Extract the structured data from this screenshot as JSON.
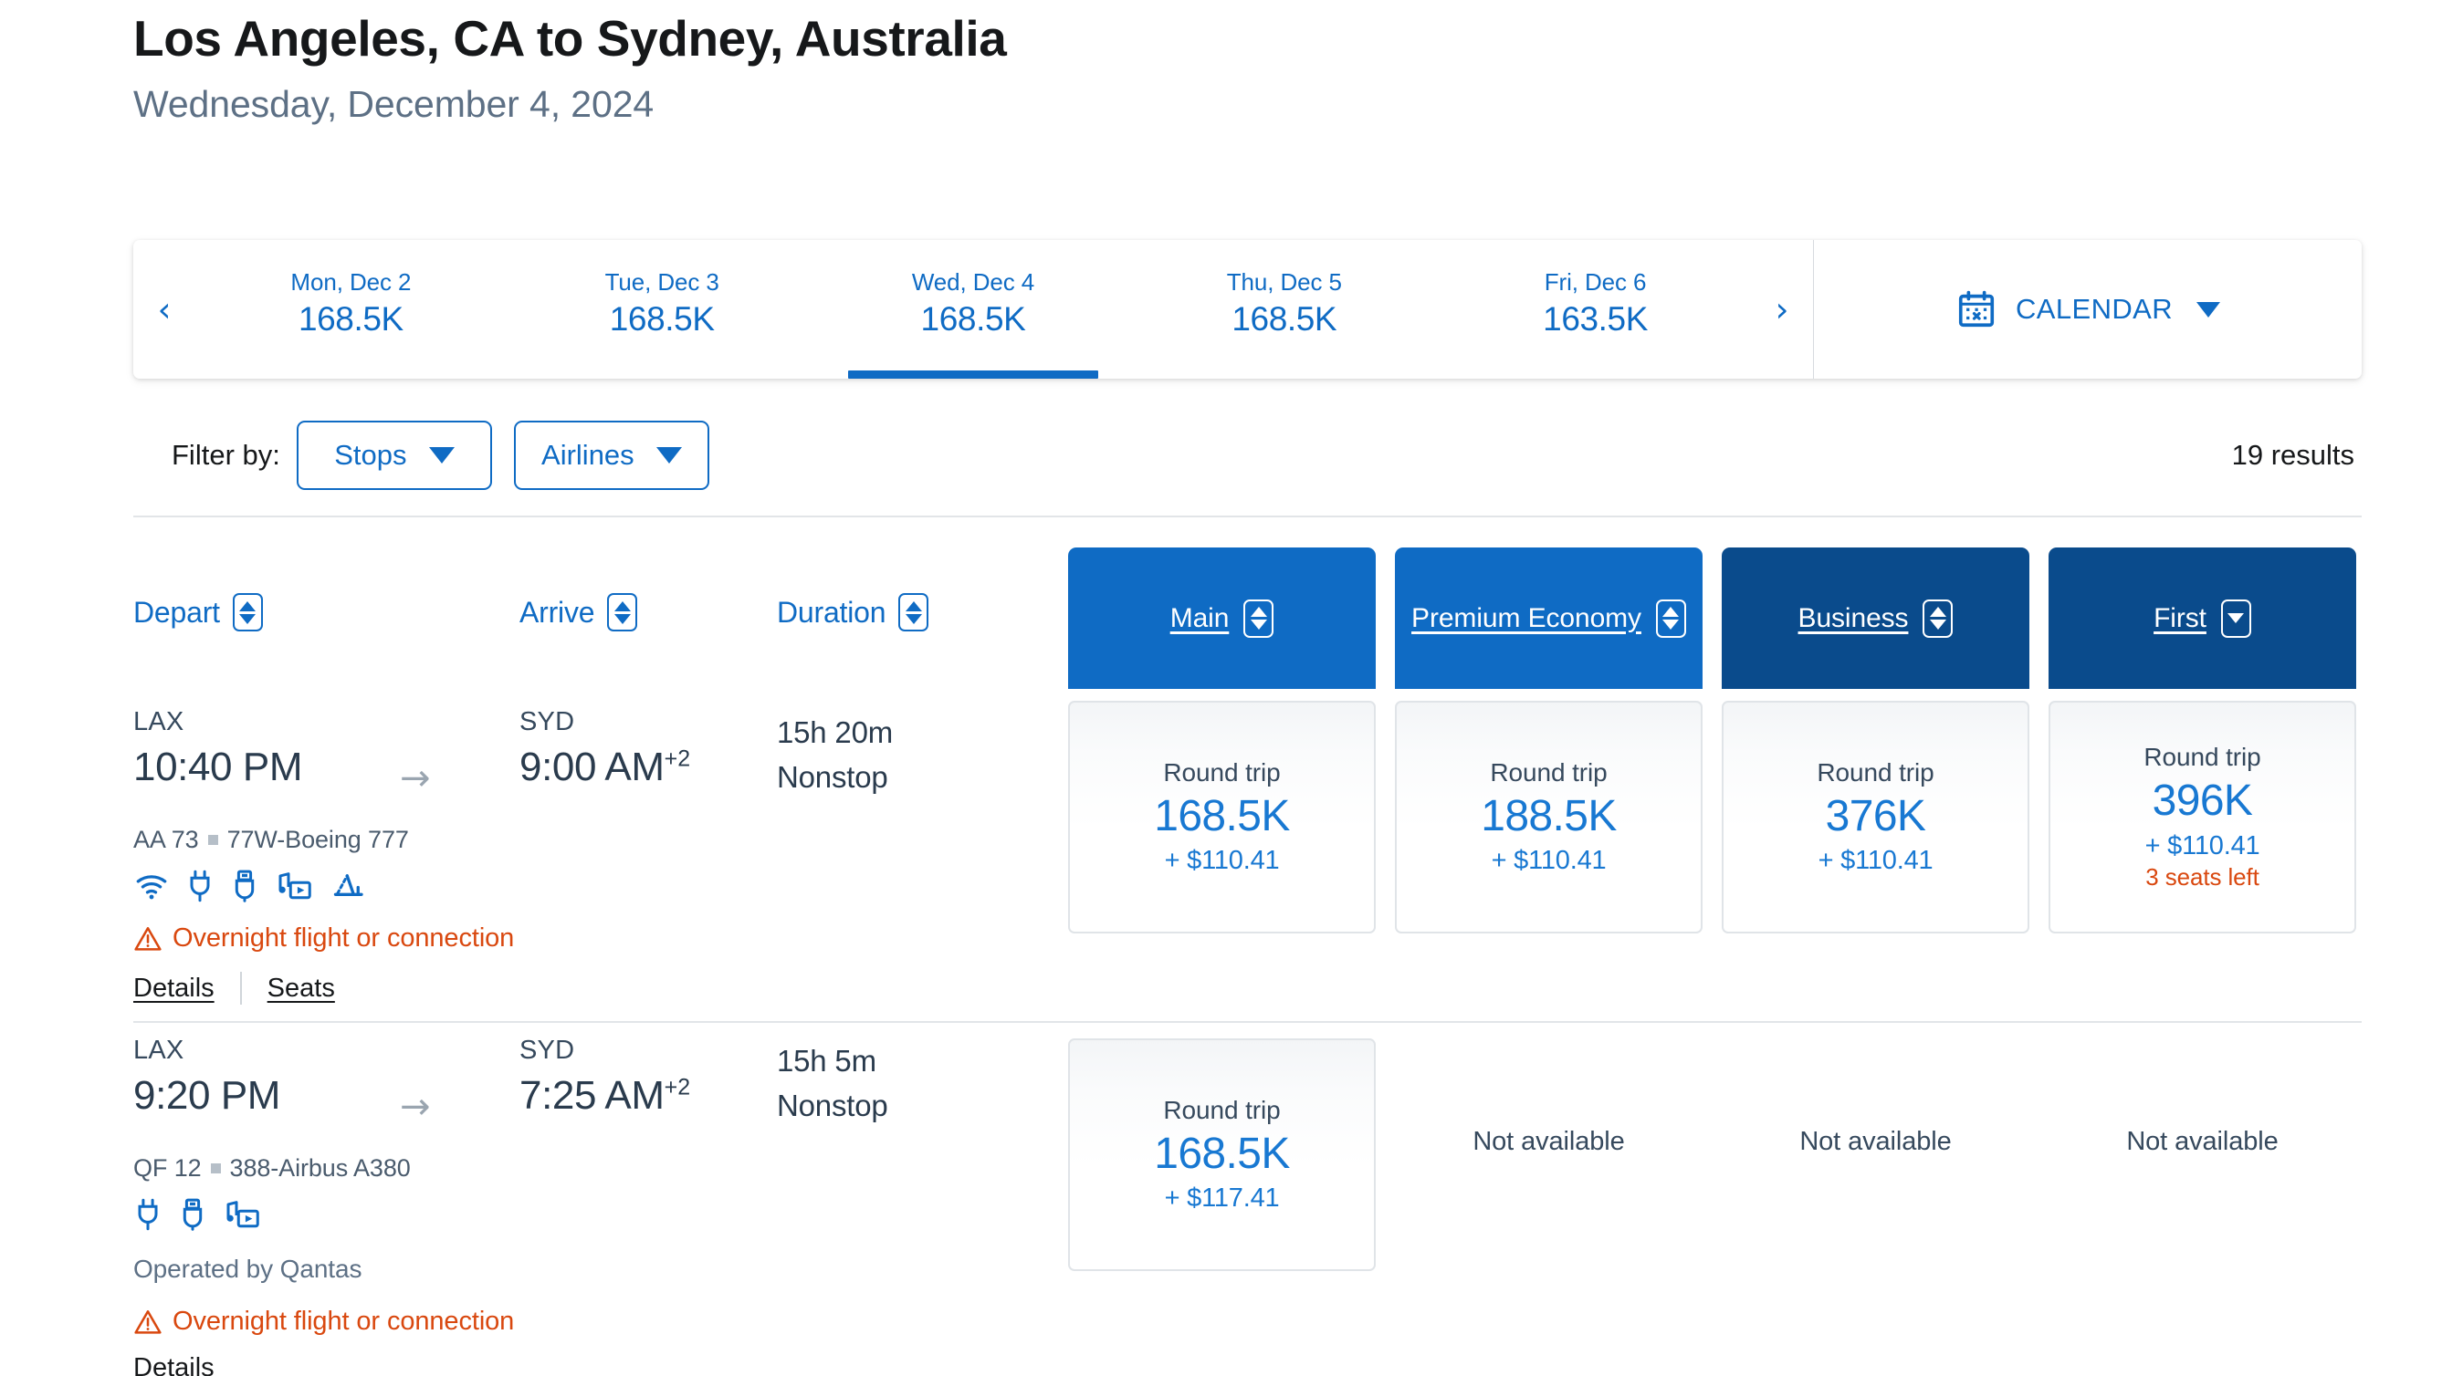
{
  "header": {
    "route_title": "Los Angeles, CA to Sydney, Australia",
    "route_date": "Wednesday, December 4, 2024"
  },
  "datestrip": {
    "prev_icon": "chevron-left-icon",
    "next_icon": "chevron-right-icon",
    "prev_glyph": "‹",
    "next_glyph": "›",
    "days": [
      {
        "label": "Mon, Dec 2",
        "price": "168.5K",
        "selected": false
      },
      {
        "label": "Tue, Dec 3",
        "price": "168.5K",
        "selected": false
      },
      {
        "label": "Wed, Dec 4",
        "price": "168.5K",
        "selected": true
      },
      {
        "label": "Thu, Dec 5",
        "price": "168.5K",
        "selected": false
      },
      {
        "label": "Fri, Dec 6",
        "price": "163.5K",
        "selected": false
      }
    ],
    "calendar_label": "CALENDAR",
    "calendar_icon": "calendar-icon"
  },
  "filters": {
    "label": "Filter by:",
    "buttons": [
      {
        "label": "Stops"
      },
      {
        "label": "Airlines"
      }
    ],
    "results_count": "19 results"
  },
  "columns": {
    "depart": "Depart",
    "arrive": "Arrive",
    "duration": "Duration"
  },
  "cabins": [
    {
      "label": "Main",
      "color": "#0f6bc4",
      "sort": "both"
    },
    {
      "label": "Premium Economy",
      "color": "#0f6bc4",
      "sort": "both"
    },
    {
      "label": "Business",
      "color": "#0a4b8c",
      "sort": "both"
    },
    {
      "label": "First",
      "color": "#0a4b8c",
      "sort": "down"
    }
  ],
  "flights": [
    {
      "depart_airport": "LAX",
      "depart_time": "10:40 PM",
      "arrive_airport": "SYD",
      "arrive_time": "9:00 AM",
      "arrive_day_offset": "+2",
      "duration": "15h 20m",
      "stops": "Nonstop",
      "flight_number": "AA 73",
      "aircraft": "77W-Boeing 777",
      "amenities": [
        "wifi-icon",
        "power-outlet-icon",
        "usb-port-icon",
        "entertainment-icon",
        "lie-flat-seat-icon"
      ],
      "operated_by": "",
      "warning": "Overnight flight or connection",
      "links": [
        "Details",
        "Seats"
      ],
      "fares": [
        {
          "available": true,
          "label": "Round trip",
          "miles": "168.5K",
          "cash": "+ $110.41",
          "seats_left": ""
        },
        {
          "available": true,
          "label": "Round trip",
          "miles": "188.5K",
          "cash": "+ $110.41",
          "seats_left": ""
        },
        {
          "available": true,
          "label": "Round trip",
          "miles": "376K",
          "cash": "+ $110.41",
          "seats_left": ""
        },
        {
          "available": true,
          "label": "Round trip",
          "miles": "396K",
          "cash": "+ $110.41",
          "seats_left": "3 seats left"
        }
      ]
    },
    {
      "depart_airport": "LAX",
      "depart_time": "9:20 PM",
      "arrive_airport": "SYD",
      "arrive_time": "7:25 AM",
      "arrive_day_offset": "+2",
      "duration": "15h 5m",
      "stops": "Nonstop",
      "flight_number": "QF 12",
      "aircraft": "388-Airbus A380",
      "amenities": [
        "power-outlet-icon",
        "usb-port-icon",
        "entertainment-icon"
      ],
      "operated_by": "Operated by Qantas",
      "warning": "Overnight flight or connection",
      "links": [
        "Details"
      ],
      "fares": [
        {
          "available": true,
          "label": "Round trip",
          "miles": "168.5K",
          "cash": "+ $117.41",
          "seats_left": ""
        },
        {
          "available": false,
          "unavailable_text": "Not available"
        },
        {
          "available": false,
          "unavailable_text": "Not available"
        },
        {
          "available": false,
          "unavailable_text": "Not available"
        }
      ]
    }
  ],
  "colors": {
    "link_blue": "#0f6bc4",
    "price_blue": "#1878d2",
    "cabin_light": "#0f6bc4",
    "cabin_dark": "#0a4b8c",
    "warning_orange": "#d9480f",
    "text_dark": "#2a3b4d",
    "text_muted": "#5d7085"
  }
}
